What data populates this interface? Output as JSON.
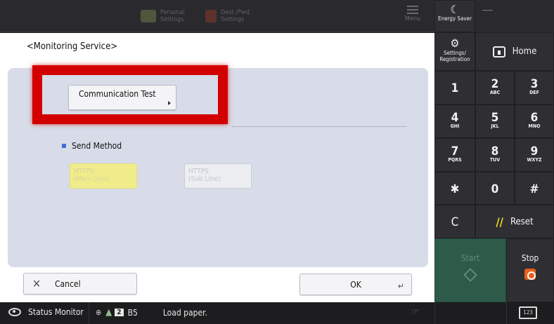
{
  "topbar": {
    "personal_settings": "Personal\nSettings",
    "dest_pwd_settings": "Dest./Pwd.\nSettings",
    "menu_label": "Menu"
  },
  "main": {
    "title": "<Monitoring Service>",
    "communication_test_label": "Communication Test",
    "send_method_label": "Send Method",
    "options": [
      {
        "label": "HTTPS\n(Main Line)",
        "selected": true
      },
      {
        "label": "HTTPS\n(Sub Line)",
        "selected": false
      }
    ],
    "cancel_label": "Cancel",
    "ok_label": "OK"
  },
  "status": {
    "status_monitor_label": "Status Monitor",
    "tray_number": "2",
    "paper_size": "B5",
    "message": "Load paper.",
    "keyboard_label": "123"
  },
  "panel": {
    "energy_saver_label": "Energy Saver",
    "dashes": "-----",
    "settings_label": "Settings/\nRegistration",
    "home_label": "Home",
    "keys": [
      {
        "main": "1",
        "sub": ""
      },
      {
        "main": "2",
        "sub": "ABC"
      },
      {
        "main": "3",
        "sub": "DEF"
      },
      {
        "main": "4",
        "sub": "GHI"
      },
      {
        "main": "5",
        "sub": "JKL"
      },
      {
        "main": "6",
        "sub": "MNO"
      },
      {
        "main": "7",
        "sub": "PQRS"
      },
      {
        "main": "8",
        "sub": "TUV"
      },
      {
        "main": "9",
        "sub": "WXYZ"
      },
      {
        "main": "✱",
        "sub": ""
      },
      {
        "main": "0",
        "sub": ""
      },
      {
        "main": "#",
        "sub": ""
      }
    ],
    "clear_label": "C",
    "reset_label": "Reset",
    "start_label": "Start",
    "stop_label": "Stop"
  },
  "colors": {
    "highlight": "#d20000",
    "selected_option": "#f1ec8a",
    "start_button": "#2e5a4a",
    "stop_icon": "#e8601c"
  }
}
